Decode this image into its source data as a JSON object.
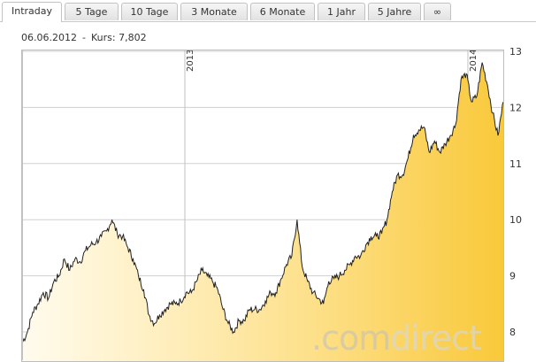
{
  "tabs": [
    {
      "label": "Intraday",
      "active": true
    },
    {
      "label": "5 Tage",
      "active": false
    },
    {
      "label": "10 Tage",
      "active": false
    },
    {
      "label": "3 Monate",
      "active": false
    },
    {
      "label": "6 Monate",
      "active": false
    },
    {
      "label": "1 Jahr",
      "active": false
    },
    {
      "label": "5 Jahre",
      "active": false
    },
    {
      "label": "∞",
      "active": false
    }
  ],
  "readout": {
    "date": "06.06.2012",
    "separator": "-",
    "kurs_label": "Kurs:",
    "kurs_value": "7,802"
  },
  "watermark": {
    "prefix": ".com",
    "brand": "direct"
  },
  "colors": {
    "fill_light": "#fff6dc",
    "fill_dark": "#f9c93a",
    "line": "#222222",
    "cursor": "#f5c63c",
    "grid": "#c8c8c8"
  },
  "chart_data": {
    "type": "area",
    "x_start": "06.06.2012",
    "year_markers": [
      "2013",
      "2014"
    ],
    "ylim": [
      7.8,
      13.0
    ],
    "yticks": [
      8,
      9,
      10,
      11,
      12,
      13
    ],
    "ytick_labels": [
      "8",
      "9",
      "10",
      "11",
      "12",
      "13"
    ],
    "grid": true,
    "values": [
      7.8,
      8.0,
      8.35,
      8.5,
      8.7,
      8.6,
      8.9,
      9.0,
      9.3,
      9.1,
      9.3,
      9.25,
      9.45,
      9.55,
      9.6,
      9.7,
      9.8,
      10.0,
      9.75,
      9.7,
      9.5,
      9.3,
      9.0,
      8.75,
      8.3,
      8.15,
      8.3,
      8.4,
      8.5,
      8.5,
      8.55,
      8.7,
      8.7,
      8.9,
      9.1,
      9.0,
      8.9,
      8.75,
      8.4,
      8.15,
      8.0,
      8.2,
      8.2,
      8.4,
      8.4,
      8.4,
      8.55,
      8.7,
      8.7,
      8.95,
      9.2,
      9.35,
      10.0,
      9.15,
      8.9,
      8.7,
      8.6,
      8.5,
      8.9,
      8.95,
      9.0,
      9.1,
      9.2,
      9.35,
      9.35,
      9.55,
      9.7,
      9.7,
      9.75,
      10.0,
      10.5,
      10.8,
      10.8,
      11.1,
      11.5,
      11.6,
      11.65,
      11.2,
      11.4,
      11.2,
      11.35,
      11.5,
      11.7,
      12.5,
      12.6,
      12.1,
      12.2,
      12.8,
      12.4,
      11.9,
      11.5,
      12.1
    ]
  }
}
